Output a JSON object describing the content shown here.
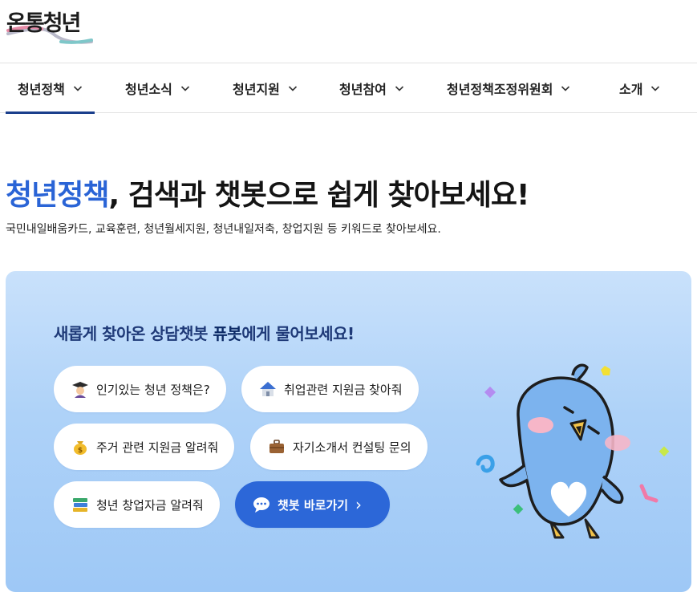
{
  "brand": {
    "logo_text": "온통청년"
  },
  "nav": {
    "items": [
      {
        "label": "청년정책",
        "active": true
      },
      {
        "label": "청년소식"
      },
      {
        "label": "청년지원"
      },
      {
        "label": "청년참여"
      },
      {
        "label": "청년정책조정위원회"
      },
      {
        "label": "소개"
      }
    ]
  },
  "hero": {
    "title_accent": "청년정책",
    "title_rest": ", 검색과 챗봇으로 쉽게 찾아보세요!",
    "subtitle": "국민내일배움카드, 교육훈련, 청년월세지원, 청년내일저축, 창업지원 등 키워드로 찾아보세요."
  },
  "chatbot": {
    "title_pre": "새롭게 찾아온 상담챗봇 ",
    "title_bold": "퓨봇",
    "title_post": "에게 물어보세요!",
    "chips": [
      {
        "label": "인기있는 청년 정책은?",
        "icon": "graduate-icon"
      },
      {
        "label": "취업관련 지원금 찾아줘",
        "icon": "house-icon"
      },
      {
        "label": "주거 관련 지원금 알려줘",
        "icon": "money-bag-icon"
      },
      {
        "label": "자기소개서 컨설팅 문의",
        "icon": "briefcase-icon"
      },
      {
        "label": "청년 창업자금 알려줘",
        "icon": "books-icon"
      }
    ],
    "go_button": {
      "label": "챗봇 바로가기",
      "icon": "speech-bubble-icon",
      "arrow": "›"
    }
  },
  "colors": {
    "accent": "#2a64d6",
    "nav_active": "#1a3f8c",
    "panel_title": "#1f3a78",
    "primary_button": "#2c67d8"
  }
}
